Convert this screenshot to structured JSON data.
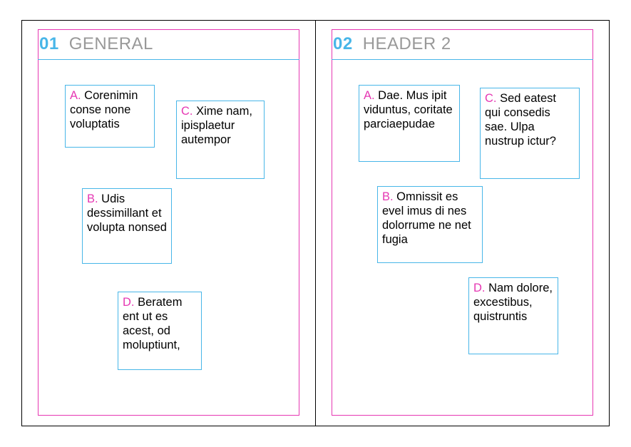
{
  "pages": [
    {
      "number": "01",
      "title": "GENERAL",
      "items": {
        "a": {
          "letter": "A.",
          "text": " Corenimin conse none voluptatis"
        },
        "b": {
          "letter": "B.",
          "text": "  Udis dessimillant et volupta nonsed"
        },
        "c": {
          "letter": "C.",
          "text": "  Xime nam, ipisplaetur autempor"
        },
        "d": {
          "letter": "D.",
          "text": "  Beratem ent ut es acest, od moluptiunt,"
        }
      }
    },
    {
      "number": "02",
      "title": "HEADER 2",
      "items": {
        "a": {
          "letter": "A.",
          "text": " Dae. Mus ipit viduntus, coritate parciaepudae"
        },
        "b": {
          "letter": "B.",
          "text": "  Omnissit es evel imus di nes dolorrume ne net fugia"
        },
        "c": {
          "letter": "C.",
          "text": "  Sed eatest qui consedis sae. Ulpa nustrup ictur?"
        },
        "d": {
          "letter": "D.",
          "text": "  Nam dolore, excestibus, quistruntis"
        }
      }
    }
  ]
}
